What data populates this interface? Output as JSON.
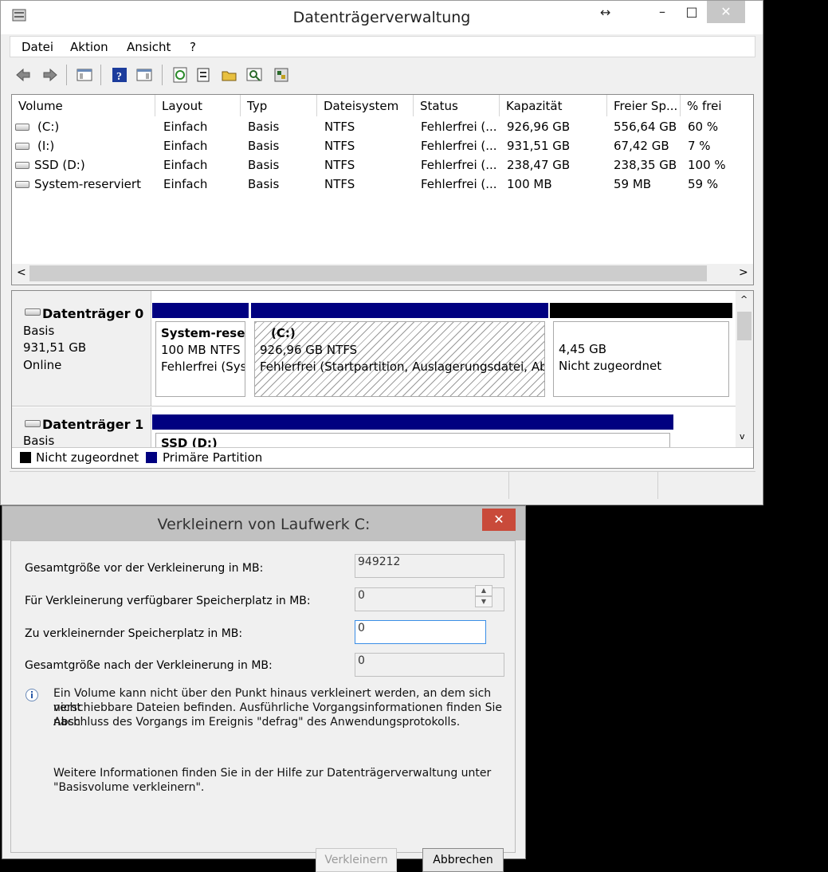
{
  "window": {
    "title": "Datenträgerverwaltung",
    "controls": {
      "minimize": "–",
      "maximize": "□",
      "close": "✕",
      "resize": "↔"
    }
  },
  "menu": [
    "Datei",
    "Aktion",
    "Ansicht",
    "?"
  ],
  "toolbar": {
    "icons": [
      "back-icon",
      "forward-icon",
      "show-hide-console-tree-icon",
      "help-icon",
      "show-hide-action-pane-icon",
      "refresh-icon",
      "properties-icon",
      "open-icon",
      "rescan-disks-icon",
      "settings-icon"
    ]
  },
  "volume_list": {
    "columns": [
      "Volume",
      "Layout",
      "Typ",
      "Dateisystem",
      "Status",
      "Kapazität",
      "Freier Sp...",
      "% frei"
    ],
    "rows": [
      {
        "volume": "(C:)",
        "layout": "Einfach",
        "typ": "Basis",
        "fs": "NTFS",
        "status": "Fehlerfrei (...",
        "capacity": "926,96 GB",
        "free": "556,64 GB",
        "pct": "60 %"
      },
      {
        "volume": "(I:)",
        "layout": "Einfach",
        "typ": "Basis",
        "fs": "NTFS",
        "status": "Fehlerfrei (...",
        "capacity": "931,51 GB",
        "free": "67,42 GB",
        "pct": "7 %"
      },
      {
        "volume": "SSD (D:)",
        "layout": "Einfach",
        "typ": "Basis",
        "fs": "NTFS",
        "status": "Fehlerfrei (...",
        "capacity": "238,47 GB",
        "free": "238,35 GB",
        "pct": "100 %"
      },
      {
        "volume": "System-reserviert",
        "layout": "Einfach",
        "typ": "Basis",
        "fs": "NTFS",
        "status": "Fehlerfrei (...",
        "capacity": "100 MB",
        "free": "59 MB",
        "pct": "59 %"
      }
    ]
  },
  "disks": [
    {
      "name": "Datenträger 0",
      "type": "Basis",
      "size": "931,51 GB",
      "state": "Online",
      "partitions": [
        {
          "title": "System-reser",
          "line1": "100 MB NTFS",
          "line2": "Fehlerfrei (Sys"
        },
        {
          "title": "(C:)",
          "line1": "926,96 GB NTFS",
          "line2": "Fehlerfrei (Startpartition, Auslagerungsdatei, Ab"
        },
        {
          "title": "",
          "line1": "4,45 GB",
          "line2": "Nicht zugeordnet"
        }
      ]
    },
    {
      "name": "Datenträger 1",
      "type": "Basis",
      "partitions": [
        {
          "title": "SSD (D:)"
        }
      ]
    }
  ],
  "legend": [
    "Nicht zugeordnet",
    "Primäre Partition"
  ],
  "colors": {
    "primary_partition": "#000080",
    "unallocated": "#000000",
    "dialog_close": "#c94a3a",
    "focus_border": "#3a8ee6"
  },
  "dialog": {
    "title": "Verkleinern von Laufwerk C:",
    "close": "✕",
    "fields": [
      {
        "label": "Gesamtgröße vor der Verkleinerung in MB:",
        "value": "949212"
      },
      {
        "label": "Für Verkleinerung verfügbarer Speicherplatz in MB:",
        "value": "0"
      },
      {
        "label": "Zu verkleinernder Speicherplatz in MB:",
        "value": "0"
      },
      {
        "label": "Gesamtgröße nach der Verkleinerung in MB:",
        "value": "0"
      }
    ],
    "info_line1": "Ein Volume kann nicht über den Punkt hinaus verkleinert werden, an dem sich nicht",
    "info_line2": "verschiebbare Dateien befinden. Ausführliche Vorgangsinformationen finden Sie nach",
    "info_line3": "Abschluss des Vorgangs im Ereignis \"defrag\" des Anwendungsprotokolls.",
    "help_line1": "Weitere Informationen finden Sie in der Hilfe zur Datenträgerverwaltung unter",
    "help_line2": "\"Basisvolume verkleinern\".",
    "shrink_button": "Verkleinern",
    "cancel_button": "Abbrechen"
  }
}
